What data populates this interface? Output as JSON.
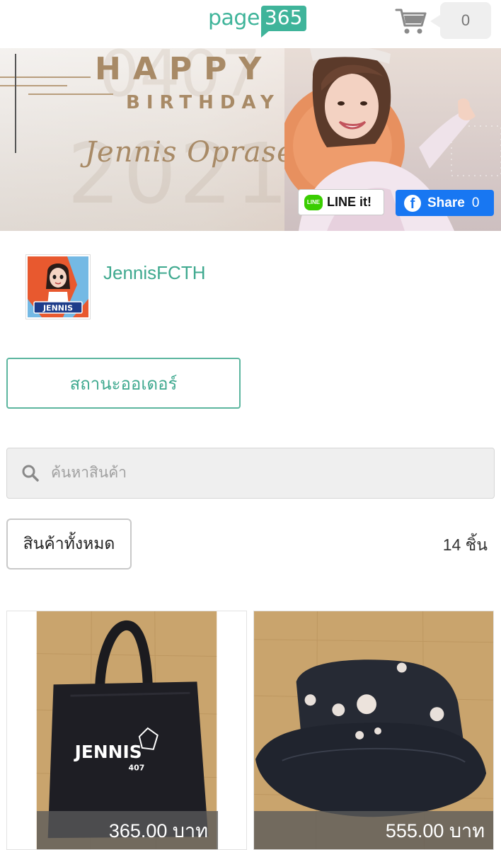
{
  "header": {
    "logo_word": "page",
    "logo_number": "365",
    "cart_count": "0"
  },
  "banner": {
    "happy": "HAPPY",
    "birthday": "BIRTHDAY",
    "script_name": "Jennis Oprasert",
    "bg_year": "2021",
    "bg_number": "0407",
    "line_button": {
      "logo_text": "LINE",
      "label": "LINE it!"
    },
    "facebook_button": {
      "label": "Share",
      "count": "0"
    }
  },
  "shop": {
    "name": "JennisFCTH",
    "avatar_caption": "JENNIS"
  },
  "order_status_button": "สถานะออเดอร์",
  "search": {
    "placeholder": "ค้นหาสินค้า"
  },
  "filter": {
    "all_products_label": "สินค้าทั้งหมด",
    "item_count": "14 ชิ้น"
  },
  "products": [
    {
      "price": "365.00 บาท",
      "print_text": "JENNIS",
      "print_sub": "407"
    },
    {
      "price": "555.00 บาท"
    }
  ],
  "colors": {
    "brand_green": "#3fb49a",
    "facebook_blue": "#1877f2",
    "line_green": "#3acd01",
    "banner_gold": "#a88a66"
  }
}
